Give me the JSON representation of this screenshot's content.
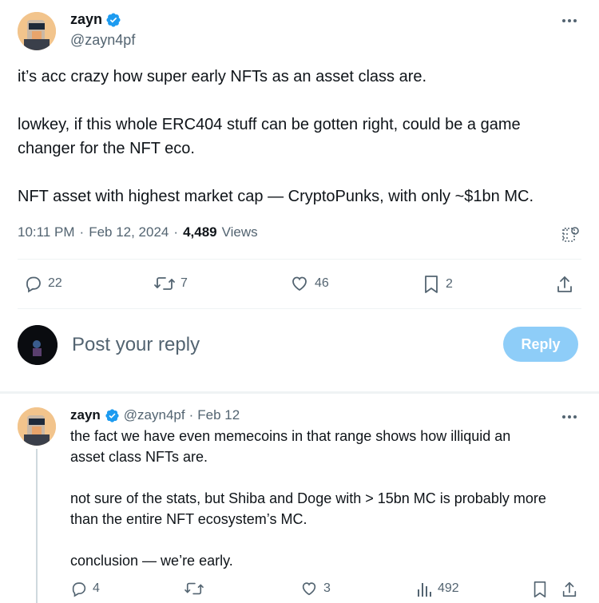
{
  "main_tweet": {
    "author_name": "zayn",
    "author_handle": "@zayn4pf",
    "text": "it’s acc crazy how super early NFTs as an asset class are.\n\nlowkey, if this whole ERC404 stuff can be gotten right, could be a game\nchanger for the NFT eco.\n\nNFT asset with highest market cap — CryptoPunks, with only ~$1bn MC.",
    "time": "10:11 PM",
    "date": "Feb 12, 2024",
    "views_count": "4,489",
    "views_label": "Views",
    "sep1": "·",
    "sep2": "·",
    "replies": "22",
    "reposts": "7",
    "likes": "46",
    "bookmarks": "2"
  },
  "reply_box": {
    "placeholder": "Post your reply",
    "button_label": "Reply"
  },
  "reply_tweet": {
    "author_name": "zayn",
    "author_handle": "@zayn4pf",
    "sep": "·",
    "date": "Feb 12",
    "text": "the fact we have even memecoins in that range shows how illiquid an\nasset class NFTs are.\n\nnot sure of the stats, but Shiba and Doge with > 15bn MC is probably more\nthan the entire NFT ecosystem’s MC.\n\nconclusion — we’re early.",
    "replies": "4",
    "reposts": "",
    "likes": "3",
    "views": "492"
  },
  "colors": {
    "verified": "#1d9bf0",
    "reply_button": "#8ecdf8",
    "secondary_text": "#536471"
  }
}
